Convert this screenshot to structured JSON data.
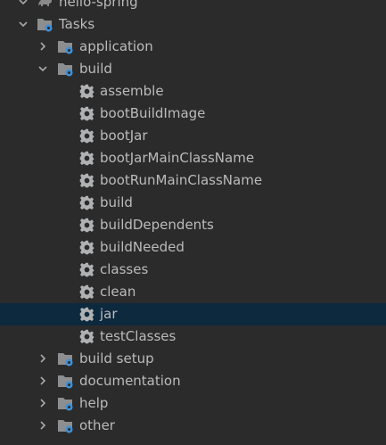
{
  "tree": {
    "project": {
      "label": "hello-spring",
      "icon": "gradle-elephant-icon"
    },
    "tasks": {
      "label": "Tasks",
      "icon": "folder-gear-icon",
      "expanded": true
    },
    "groups_before": [
      {
        "label": "application",
        "expanded": false
      }
    ],
    "build_group": {
      "label": "build",
      "expanded": true,
      "tasks": [
        "assemble",
        "bootBuildImage",
        "bootJar",
        "bootJarMainClassName",
        "bootRunMainClassName",
        "build",
        "buildDependents",
        "buildNeeded",
        "classes",
        "clean",
        "jar",
        "testClasses"
      ],
      "selected_task": "jar"
    },
    "groups_after": [
      {
        "label": "build setup",
        "expanded": false
      },
      {
        "label": "documentation",
        "expanded": false
      },
      {
        "label": "help",
        "expanded": false
      },
      {
        "label": "other",
        "expanded": false
      }
    ]
  },
  "colors": {
    "background": "#2b2b2b",
    "selection": "#0d293e",
    "text": "#bbbbbb",
    "icon": "#afb1b3",
    "gear_badge": "#3f8fd3"
  }
}
